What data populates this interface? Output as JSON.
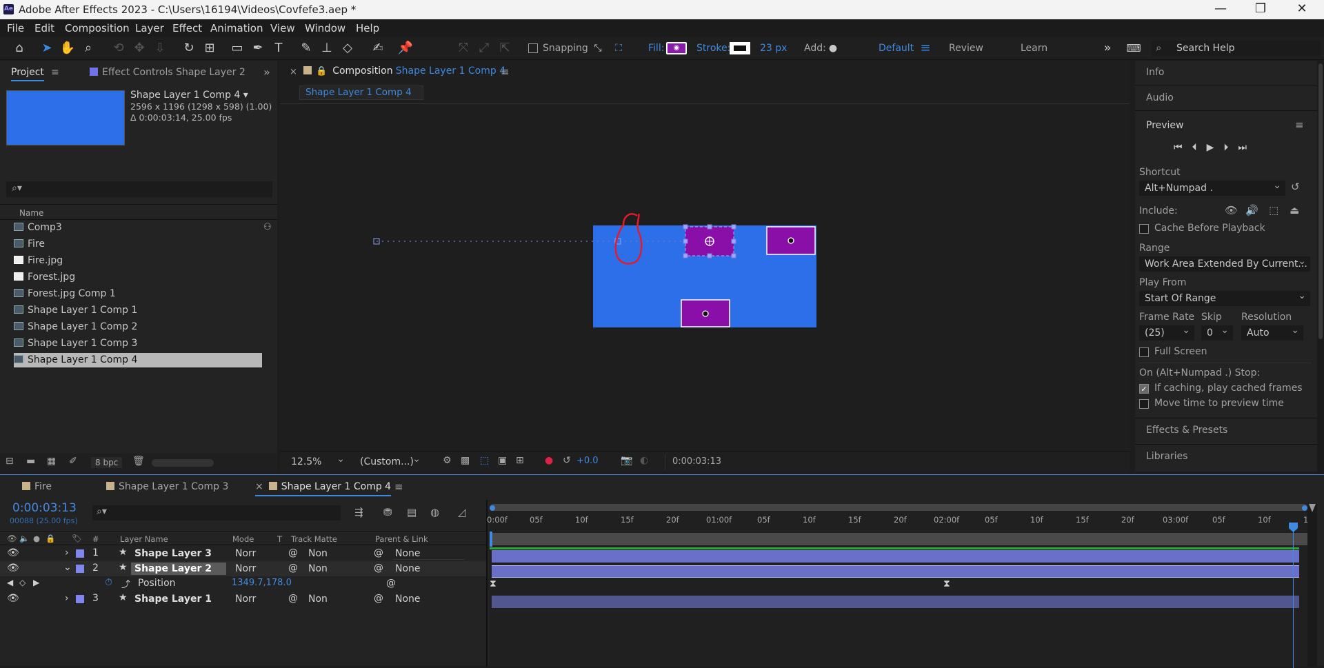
{
  "window": {
    "app_badge": "Ae",
    "title": "Adobe After Effects 2023 - C:\\Users\\16194\\Videos\\Covfefe3.aep *",
    "minimize": "—",
    "maximize": "❐",
    "close": "✕"
  },
  "menu": [
    "File",
    "Edit",
    "Composition",
    "Layer",
    "Effect",
    "Animation",
    "View",
    "Window",
    "Help"
  ],
  "toolbar": {
    "snapping": "Snapping",
    "fill_label": "Fill:",
    "stroke_label": "Stroke:",
    "stroke_px": "23 px",
    "add_label": "Add:",
    "workspaces": [
      "Default",
      "Review",
      "Learn"
    ],
    "search_placeholder": "Search Help",
    "more": "»",
    "colors": {
      "fill": "#8a1aa8",
      "accent": "#3f8ae0"
    }
  },
  "project": {
    "tab_project": "Project",
    "tab_effect_controls": "Effect Controls Shape Layer 2",
    "selected_name": "Shape Layer 1 Comp 4 ▾",
    "selected_dims": "2596 x 1196  (1298 x 598) (1.00)",
    "selected_duration": "Δ 0:00:03:14, 25.00 fps",
    "search_icon": "⌕▾",
    "column_name": "Name",
    "items": [
      "Comp3",
      "Fire",
      "Fire.jpg",
      "Forest.jpg",
      "Forest.jpg Comp 1",
      "Shape Layer 1 Comp 1",
      "Shape Layer 1 Comp 2",
      "Shape Layer 1 Comp 3",
      "Shape Layer 1 Comp 4"
    ],
    "bpc": "8 bpc"
  },
  "composition": {
    "tab_prefix": "Composition",
    "tab_name": "Shape Layer 1 Comp 4",
    "subtab": "Shape Layer 1 Comp 4",
    "zoom": "12.5%",
    "resolution": "(Custom...)",
    "exposure": "+0.0",
    "timecode": "0:00:03:13",
    "canvas_color": "#2c6fe8",
    "shape_color": "#8a0fa8"
  },
  "right_panel": {
    "info": "Info",
    "audio": "Audio",
    "preview": "Preview",
    "shortcut_label": "Shortcut",
    "shortcut_value": "Alt+Numpad .",
    "include_label": "Include:",
    "cache_before": "Cache Before Playback",
    "range_label": "Range",
    "range_value": "Work Area Extended By Current...",
    "play_from_label": "Play From",
    "play_from_value": "Start Of Range",
    "frame_rate_label": "Frame Rate",
    "skip_label": "Skip",
    "resolution_label": "Resolution",
    "frame_rate_value": "(25)",
    "skip_value": "0",
    "resolution_value": "Auto",
    "full_screen": "Full Screen",
    "stop_label": "On (Alt+Numpad .) Stop:",
    "if_caching": "If caching, play cached frames",
    "move_time": "Move time to preview time",
    "effects_presets": "Effects & Presets",
    "libraries": "Libraries"
  },
  "timeline": {
    "tabs": [
      "Fire",
      "Shape Layer 1 Comp 3",
      "Shape Layer 1 Comp 4"
    ],
    "timecode": "0:00:03:13",
    "frames": "00088 (25.00 fps)",
    "col_hash": "#",
    "col_layer_name": "Layer Name",
    "col_mode": "Mode",
    "col_t": "T",
    "col_track_matte": "Track Matte",
    "col_parent": "Parent & Link",
    "ruler": [
      "0:00f",
      "05f",
      "10f",
      "15f",
      "20f",
      "01:00f",
      "05f",
      "10f",
      "15f",
      "20f",
      "02:00f",
      "05f",
      "10f",
      "15f",
      "20f",
      "03:00f",
      "05f",
      "10f",
      "1"
    ],
    "layers": [
      {
        "num": "1",
        "name": "Shape Layer 3",
        "mode": "Norr",
        "matte": "Non",
        "parent": "None"
      },
      {
        "num": "2",
        "name": "Shape Layer 2",
        "mode": "Norr",
        "matte": "Non",
        "parent": "None"
      },
      {
        "num": "3",
        "name": "Shape Layer 1",
        "mode": "Norr",
        "matte": "Non",
        "parent": "None"
      }
    ],
    "position_label": "Position",
    "position_value": "1349.7,178.0",
    "label_color": "#7f86ee"
  }
}
